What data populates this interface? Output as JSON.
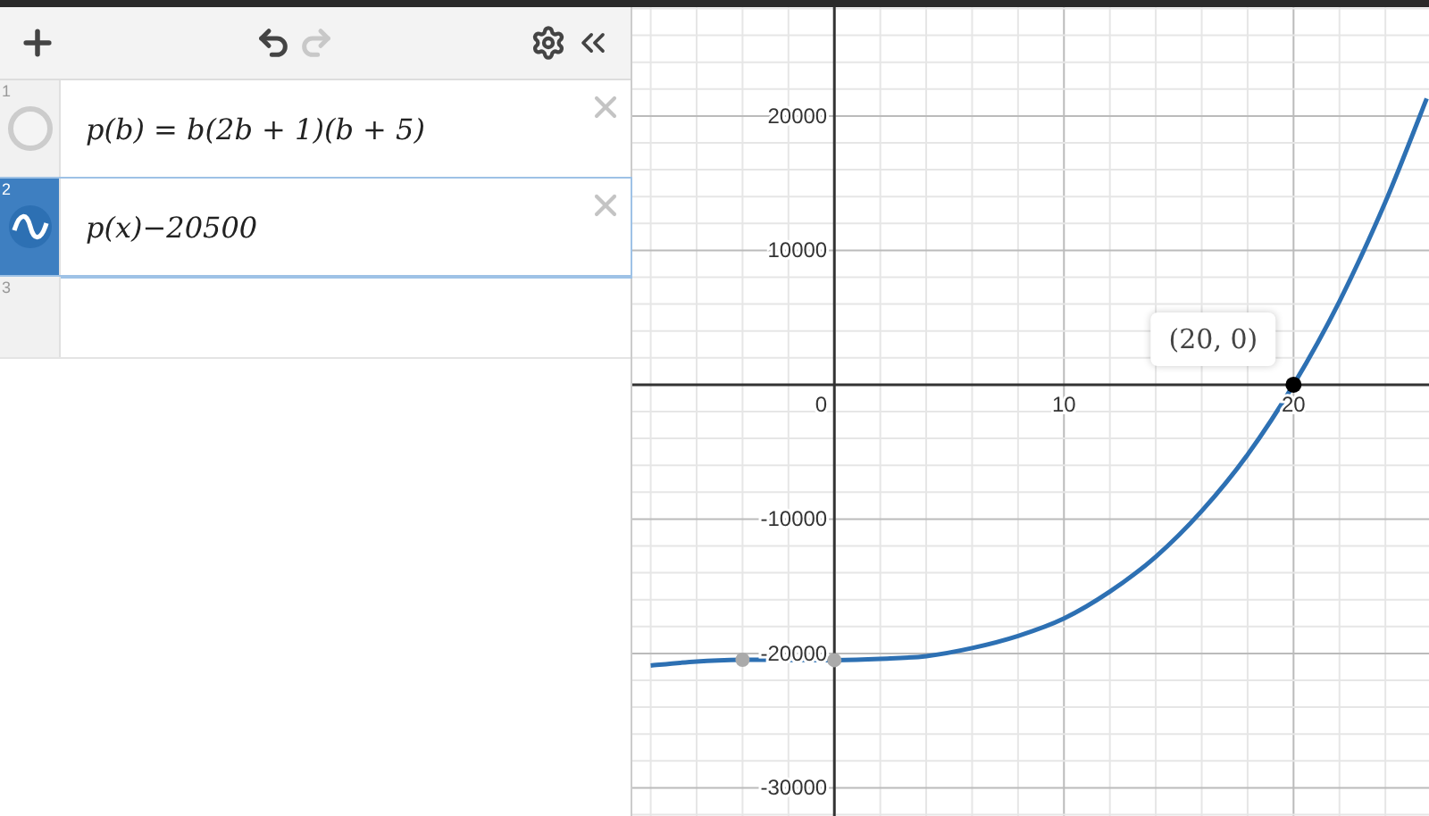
{
  "toolbar": {
    "undo_disabled": false,
    "redo_disabled": true
  },
  "expressions": [
    {
      "number": "1",
      "text": "p(b) = b(2b + 1)(b + 5)",
      "selected": false,
      "shown": false
    },
    {
      "number": "2",
      "text": "p(x)−20500",
      "selected": true,
      "shown": true
    },
    {
      "number": "3",
      "selected": false,
      "shown": false
    }
  ],
  "graph": {
    "chart_data": {
      "type": "line",
      "x": [
        -8,
        -6,
        -4,
        -2,
        0,
        2,
        4,
        6,
        8,
        10,
        12,
        14,
        16,
        18,
        20,
        22,
        24,
        25.8
      ],
      "series": [
        {
          "color": "#2d70b3",
          "values": [
            -20900,
            -20600,
            -20472,
            -20482,
            -20500,
            -20400,
            -20200,
            -19600,
            -18700,
            -17400,
            -15400,
            -12800,
            -9400,
            -5200,
            0,
            6200,
            13600,
            21300
          ]
        }
      ],
      "xlim": [
        -8.8,
        25.9
      ],
      "ylim": [
        -32100,
        28100
      ],
      "xticks": [
        0,
        10,
        20
      ],
      "yticks": [
        -30000,
        -20000,
        -10000,
        10000,
        20000
      ],
      "grid": true,
      "annotations": [
        {
          "x": 20,
          "y": 0,
          "text": "(20, 0)"
        }
      ]
    }
  }
}
